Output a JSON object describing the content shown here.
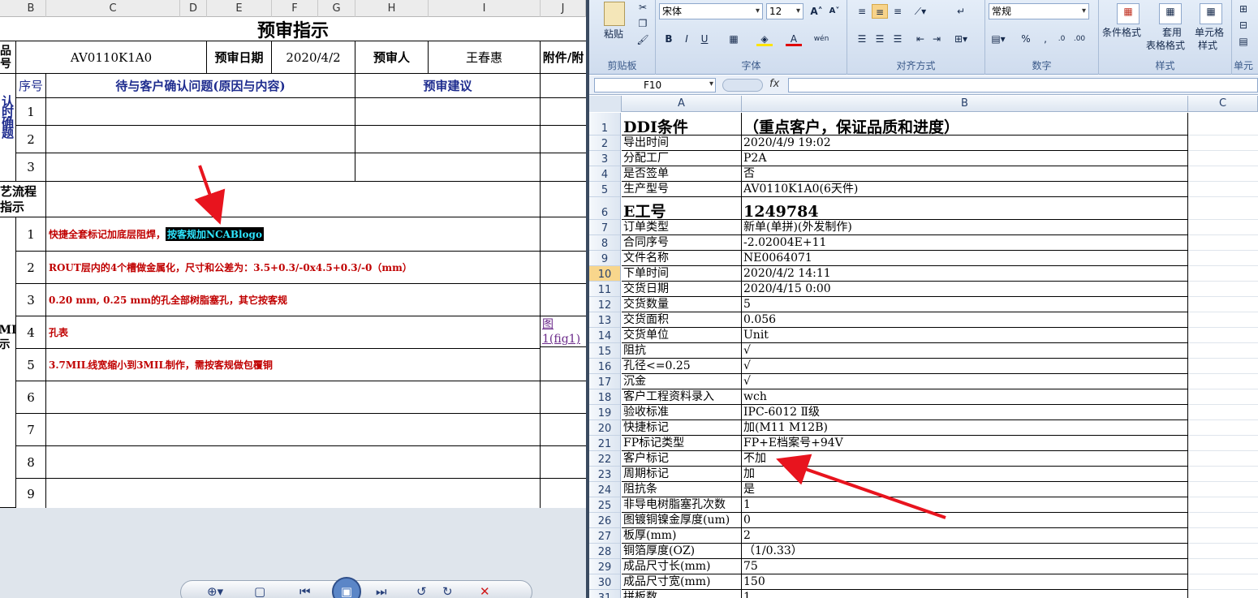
{
  "left": {
    "col_headers": [
      "B",
      "C",
      "D",
      "E",
      "F",
      "G",
      "H",
      "I",
      "J"
    ],
    "title": "预审指示",
    "row1": {
      "prefix": "品号",
      "code": "AV0110K1A0",
      "date_label": "预审日期",
      "date": "2020/4/2",
      "reviewer_label": "预审人",
      "reviewer": "王春惠",
      "attach_label": "附件/附"
    },
    "confirm_side": "认时确题",
    "confirm_header": {
      "seq": "序号",
      "question": "待与客户确认问题(原因与内容)",
      "advice": "预审建议"
    },
    "confirm_rows": [
      "1",
      "2",
      "3"
    ],
    "process_side": "艺流程指示",
    "mi_side": "MI示",
    "instructions": [
      {
        "n": "1",
        "text": "快捷全套标记加底层阻焊，",
        "highlight": "按客规加NCABlogo"
      },
      {
        "n": "2",
        "text": "ROUT层内的4个槽做金属化，尺寸和公差为：3.5+0.3/-0x4.5+0.3/-0（mm）",
        "highlight": ""
      },
      {
        "n": "3",
        "text": "0.20 mm, 0.25 mm的孔全部树脂塞孔，其它按客规",
        "highlight": ""
      },
      {
        "n": "4",
        "text": "孔表",
        "highlight": ""
      },
      {
        "n": "5",
        "text": "3.7MIL线宽缩小到3MIL制作，需按客规做包覆铜",
        "highlight": ""
      },
      {
        "n": "6",
        "text": "",
        "highlight": ""
      },
      {
        "n": "7",
        "text": "",
        "highlight": ""
      },
      {
        "n": "8",
        "text": "",
        "highlight": ""
      },
      {
        "n": "9",
        "text": "",
        "highlight": ""
      }
    ],
    "attach_link": "图1(fig1)"
  },
  "ribbon": {
    "paste": "粘贴",
    "clipboard": "剪贴板",
    "font_name": "宋体",
    "font_size": "12",
    "font_group": "字体",
    "align_group": "对齐方式",
    "number_format": "常规",
    "number_group": "数字",
    "cond_format": "条件格式",
    "table_format_1": "套用",
    "table_format_2": "表格格式",
    "cell_style_1": "单元格",
    "cell_style_2": "样式",
    "styles_group": "样式",
    "cells_group": "单元"
  },
  "formula_bar": {
    "name_box": "F10",
    "fx": "fx",
    "value": ""
  },
  "excel": {
    "col_headers": [
      "A",
      "B",
      "C"
    ],
    "rows": [
      {
        "n": "1",
        "a": "DDI条件",
        "b": "（重点客户，保证品质和进度）",
        "big": true
      },
      {
        "n": "2",
        "a": "导出时间",
        "b": "2020/4/9 19:02"
      },
      {
        "n": "3",
        "a": "分配工厂",
        "b": "P2A"
      },
      {
        "n": "4",
        "a": "是否签单",
        "b": "否"
      },
      {
        "n": "5",
        "a": "生产型号",
        "b": "AV0110K1A0(6天件)"
      },
      {
        "n": "6",
        "a": "E工号",
        "b": "1249784",
        "big": true
      },
      {
        "n": "7",
        "a": "订单类型",
        "b": "新单(单拼)(外发制作)"
      },
      {
        "n": "8",
        "a": "合同序号",
        "b": "-2.02004E+11"
      },
      {
        "n": "9",
        "a": "文件名称",
        "b": "NE0064071"
      },
      {
        "n": "10",
        "a": "下单时间",
        "b": "2020/4/2 14:11"
      },
      {
        "n": "11",
        "a": "交货日期",
        "b": "2020/4/15 0:00"
      },
      {
        "n": "12",
        "a": "交货数量",
        "b": "5"
      },
      {
        "n": "13",
        "a": "交货面积",
        "b": "0.056"
      },
      {
        "n": "14",
        "a": "交货单位",
        "b": "Unit"
      },
      {
        "n": "15",
        "a": "阻抗",
        "b": "√"
      },
      {
        "n": "16",
        "a": "孔径<=0.25",
        "b": "√"
      },
      {
        "n": "17",
        "a": "沉金",
        "b": "√"
      },
      {
        "n": "18",
        "a": "客户工程资料录入",
        "b": "wch"
      },
      {
        "n": "19",
        "a": "验收标准",
        "b": "IPC-6012 Ⅱ级"
      },
      {
        "n": "20",
        "a": "快捷标记",
        "b": "加(M11 M12B)"
      },
      {
        "n": "21",
        "a": "FP标记类型",
        "b": "FP+E档案号+94V"
      },
      {
        "n": "22",
        "a": "客户标记",
        "b": "不加"
      },
      {
        "n": "23",
        "a": "周期标记",
        "b": "加"
      },
      {
        "n": "24",
        "a": "阻抗条",
        "b": "是"
      },
      {
        "n": "25",
        "a": "非导电树脂塞孔次数",
        "b": "1"
      },
      {
        "n": "26",
        "a": "图镀铜镍金厚度(um)",
        "b": "0"
      },
      {
        "n": "27",
        "a": "板厚(mm)",
        "b": "2"
      },
      {
        "n": "28",
        "a": "铜箔厚度(OZ)",
        "b": "（1/0.33）"
      },
      {
        "n": "29",
        "a": "成品尺寸长(mm)",
        "b": "75"
      },
      {
        "n": "30",
        "a": "成品尺寸宽(mm)",
        "b": "150"
      },
      {
        "n": "31",
        "a": "拼板数",
        "b": "1"
      }
    ],
    "selected_row": "10"
  },
  "colors": {
    "arrow": "#e8141e",
    "excel_blue": "#27406b",
    "highlight_bg": "#000000",
    "highlight_fg": "#2ee6ff"
  }
}
